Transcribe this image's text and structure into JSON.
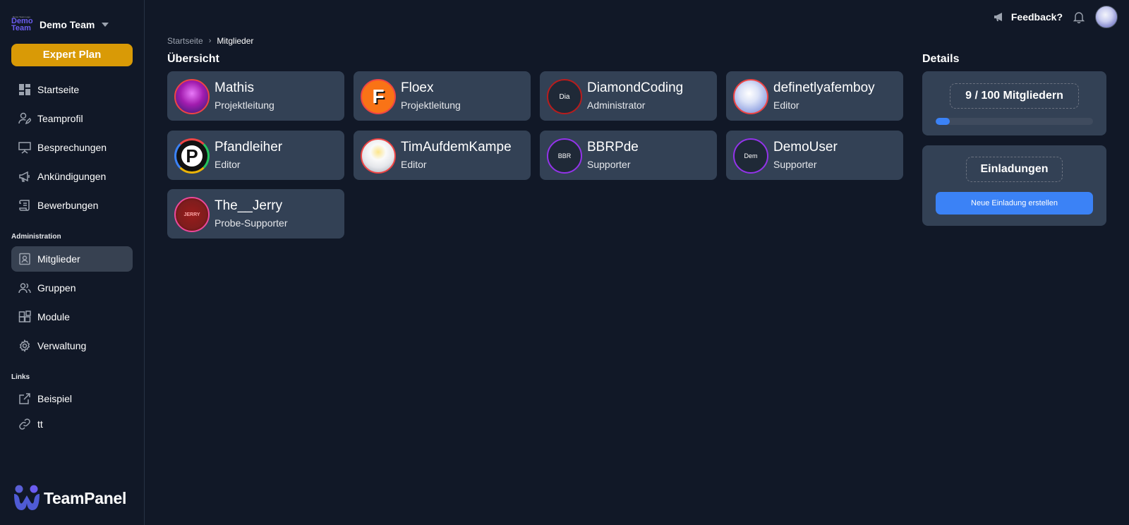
{
  "team": {
    "logo_small": "Demo Team Logo",
    "logo_line1": "Demo",
    "logo_line2": "Team",
    "name": "Demo Team"
  },
  "plan_button": "Expert Plan",
  "sidebar": {
    "items": [
      {
        "label": "Startseite",
        "icon": "dashboard-icon"
      },
      {
        "label": "Teamprofil",
        "icon": "user-edit-icon"
      },
      {
        "label": "Besprechungen",
        "icon": "presentation-icon"
      },
      {
        "label": "Ankündigungen",
        "icon": "megaphone-icon"
      },
      {
        "label": "Bewerbungen",
        "icon": "scroll-icon"
      }
    ],
    "admin_label": "Administration",
    "admin_items": [
      {
        "label": "Mitglieder",
        "icon": "id-card-icon",
        "active": true
      },
      {
        "label": "Gruppen",
        "icon": "users-icon"
      },
      {
        "label": "Module",
        "icon": "modules-icon"
      },
      {
        "label": "Verwaltung",
        "icon": "gear-icon"
      }
    ],
    "links_label": "Links",
    "link_items": [
      {
        "label": "Beispiel",
        "icon": "external-link-icon"
      },
      {
        "label": "tt",
        "icon": "link-icon"
      }
    ]
  },
  "brand": "TeamPanel",
  "topbar": {
    "feedback": "Feedback?"
  },
  "breadcrumb": {
    "home": "Startseite",
    "current": "Mitglieder"
  },
  "overview_title": "Übersicht",
  "details_title": "Details",
  "members": [
    {
      "name": "Mathis",
      "role": "Projektleitung",
      "avatar_text": ""
    },
    {
      "name": "Floex",
      "role": "Projektleitung",
      "avatar_text": "F"
    },
    {
      "name": "DiamondCoding",
      "role": "Administrator",
      "avatar_text": "Dia"
    },
    {
      "name": "definetlyafemboy",
      "role": "Editor",
      "avatar_text": ""
    },
    {
      "name": "Pfandleiher",
      "role": "Editor",
      "avatar_text": "P"
    },
    {
      "name": "TimAufdemKampe",
      "role": "Editor",
      "avatar_text": ""
    },
    {
      "name": "BBRPde",
      "role": "Supporter",
      "avatar_text": "BBR"
    },
    {
      "name": "DemoUser",
      "role": "Supporter",
      "avatar_text": "Dem"
    },
    {
      "name": "The__Jerry",
      "role": "Probe-Supporter",
      "avatar_text": "JERRY"
    }
  ],
  "details": {
    "member_count": "9 / 100 Mitgliedern",
    "progress_fraction": 0.09,
    "invites_title": "Einladungen",
    "invite_button": "Neue Einladung erstellen"
  },
  "colors": {
    "background": "#111827",
    "card": "#334155",
    "accent": "#3b82f6",
    "plan": "#d99a06",
    "brand_purple": "#6b5cf0"
  }
}
